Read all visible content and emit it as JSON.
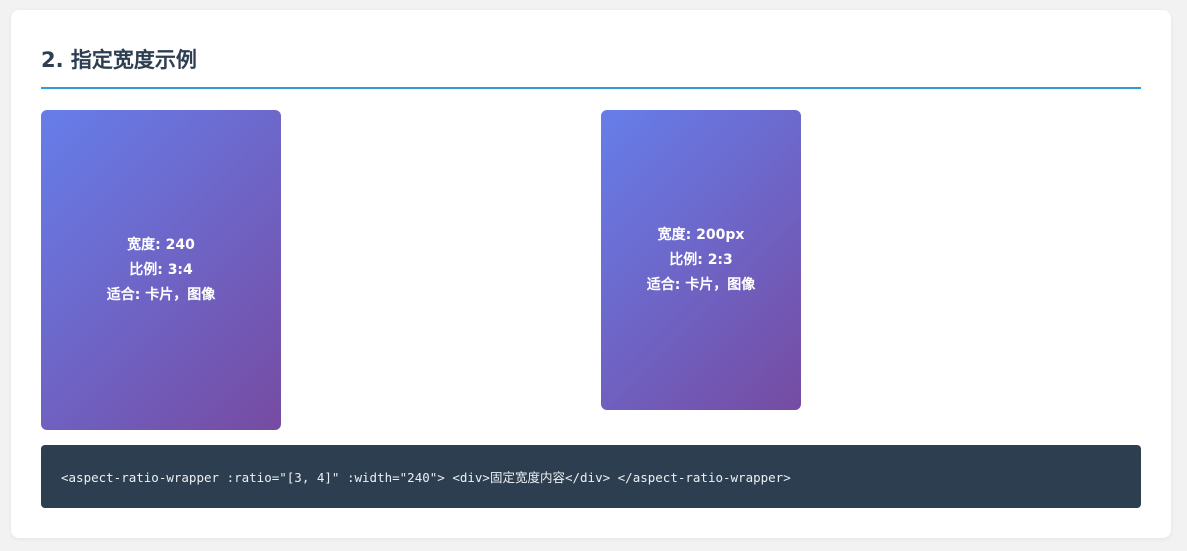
{
  "section": {
    "title": "2. 指定宽度示例"
  },
  "examples": [
    {
      "lines": [
        "宽度: 240",
        "比例: 3:4",
        "适合: 卡片，图像"
      ]
    },
    {
      "lines": [
        "宽度: 200px",
        "比例: 2:3",
        "适合: 卡片，图像"
      ]
    }
  ],
  "code": {
    "text": "<aspect-ratio-wrapper :ratio=\"[3, 4]\" :width=\"240\"> <div>固定宽度内容</div> </aspect-ratio-wrapper>"
  },
  "colors": {
    "title": "#2c3e50",
    "rule": "#3498db",
    "gradient_start": "#667eea",
    "gradient_end": "#764ba2",
    "code_background": "#2d3e50"
  }
}
